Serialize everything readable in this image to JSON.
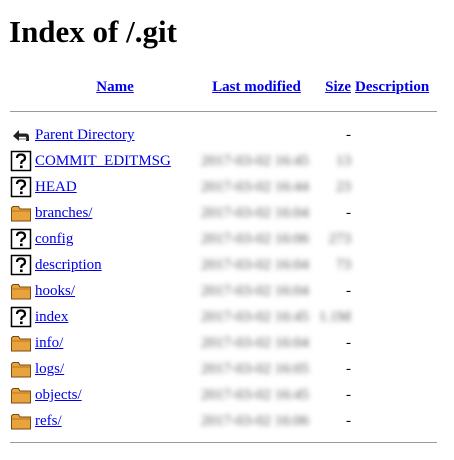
{
  "page": {
    "title": "Index of /.git"
  },
  "columns": {
    "name": "Name",
    "modified": "Last modified",
    "size": "Size",
    "description": "Description"
  },
  "rows": [
    {
      "type": "parent",
      "icon": "back-icon",
      "name": "Parent Directory",
      "modified": "",
      "size": "-"
    },
    {
      "type": "file",
      "icon": "unknown-file-icon",
      "name": "COMMIT_EDITMSG",
      "modified": "2017-03-02 16:45",
      "size": "13"
    },
    {
      "type": "file",
      "icon": "unknown-file-icon",
      "name": "HEAD",
      "modified": "2017-03-02 16:44",
      "size": "23"
    },
    {
      "type": "folder",
      "icon": "folder-icon",
      "name": "branches/",
      "modified": "2017-03-02 16:04",
      "size": "-"
    },
    {
      "type": "file",
      "icon": "unknown-file-icon",
      "name": "config",
      "modified": "2017-03-02 16:06",
      "size": "273"
    },
    {
      "type": "file",
      "icon": "unknown-file-icon",
      "name": "description",
      "modified": "2017-03-02 16:04",
      "size": "73"
    },
    {
      "type": "folder",
      "icon": "folder-icon",
      "name": "hooks/",
      "modified": "2017-03-02 16:04",
      "size": "-"
    },
    {
      "type": "file",
      "icon": "unknown-file-icon",
      "name": "index",
      "modified": "2017-03-02 16:45",
      "size": "1.1M"
    },
    {
      "type": "folder",
      "icon": "folder-icon",
      "name": "info/",
      "modified": "2017-03-02 16:04",
      "size": "-"
    },
    {
      "type": "folder",
      "icon": "folder-icon",
      "name": "logs/",
      "modified": "2017-03-02 16:05",
      "size": "-"
    },
    {
      "type": "folder",
      "icon": "folder-icon",
      "name": "objects/",
      "modified": "2017-03-02 16:45",
      "size": "-"
    },
    {
      "type": "folder",
      "icon": "folder-icon",
      "name": "refs/",
      "modified": "2017-03-02 16:06",
      "size": "-"
    }
  ],
  "colors": {
    "link": "#0000ee",
    "rule": "#9a9a9a",
    "folder_fill": "#e8a33d"
  }
}
